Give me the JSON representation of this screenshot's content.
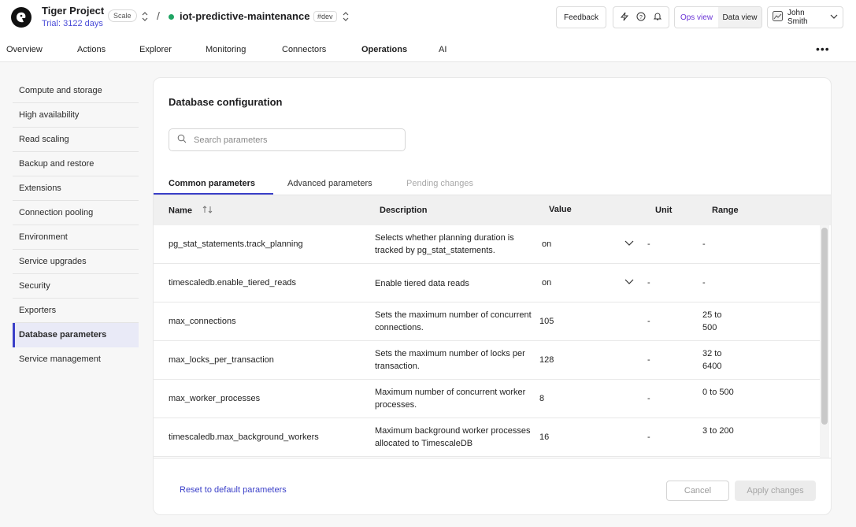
{
  "header": {
    "project_name": "Tiger Project",
    "trial": "Trial: 3122 days",
    "plan_badge": "Scale",
    "separator": "/",
    "service_name": "iot-predictive-maintenance",
    "env_badge": "#dev",
    "feedback_label": "Feedback",
    "ops_view": "Ops view",
    "data_view": "Data view",
    "user_name": "John Smith",
    "status_color": "#1fa463"
  },
  "nav": {
    "tabs": [
      {
        "label": "Overview"
      },
      {
        "label": "Actions"
      },
      {
        "label": "Explorer"
      },
      {
        "label": "Monitoring"
      },
      {
        "label": "Connectors"
      },
      {
        "label": "Operations"
      },
      {
        "label": "AI"
      }
    ],
    "active": "Operations",
    "more": "•••"
  },
  "sidebar": {
    "items": [
      {
        "label": "Compute and storage"
      },
      {
        "label": "High availability"
      },
      {
        "label": "Read scaling"
      },
      {
        "label": "Backup and restore"
      },
      {
        "label": "Extensions"
      },
      {
        "label": "Connection pooling"
      },
      {
        "label": "Environment"
      },
      {
        "label": "Service upgrades"
      },
      {
        "label": "Security"
      },
      {
        "label": "Exporters"
      },
      {
        "label": "Database parameters"
      },
      {
        "label": "Service management"
      }
    ],
    "active": "Database parameters"
  },
  "main": {
    "title": "Database configuration",
    "search_placeholder": "Search parameters",
    "tabs": [
      {
        "label": "Common parameters"
      },
      {
        "label": "Advanced parameters"
      },
      {
        "label": "Pending changes"
      }
    ],
    "columns": {
      "name": "Name",
      "description": "Description",
      "value": "Value",
      "unit": "Unit",
      "range": "Range"
    },
    "rows": [
      {
        "name": "pg_stat_statements.track_planning",
        "description": "Selects whether planning duration is tracked by pg_stat_statements.",
        "value": "on",
        "dropdown": true,
        "unit": "-",
        "range": "-"
      },
      {
        "name": "timescaledb.enable_tiered_reads",
        "description": "Enable tiered data reads",
        "value": "on",
        "dropdown": true,
        "unit": "-",
        "range": "-"
      },
      {
        "name": "max_connections",
        "description": "Sets the maximum number of concurrent connections.",
        "value": "105",
        "dropdown": false,
        "unit": "-",
        "range": "25 to 500"
      },
      {
        "name": "max_locks_per_transaction",
        "description": "Sets the maximum number of locks per transaction.",
        "value": "128",
        "dropdown": false,
        "unit": "-",
        "range": "32 to 6400"
      },
      {
        "name": "max_worker_processes",
        "description": "Maximum number of concurrent worker processes.",
        "value": "8",
        "dropdown": false,
        "unit": "-",
        "range": "0 to 500"
      },
      {
        "name": "timescaledb.max_background_workers",
        "description": "Maximum background worker processes allocated to TimescaleDB",
        "value": "16",
        "dropdown": false,
        "unit": "-",
        "range": "3 to 200"
      }
    ],
    "footer": {
      "reset_label": "Reset to default parameters",
      "cancel_label": "Cancel",
      "apply_label": "Apply changes"
    }
  }
}
